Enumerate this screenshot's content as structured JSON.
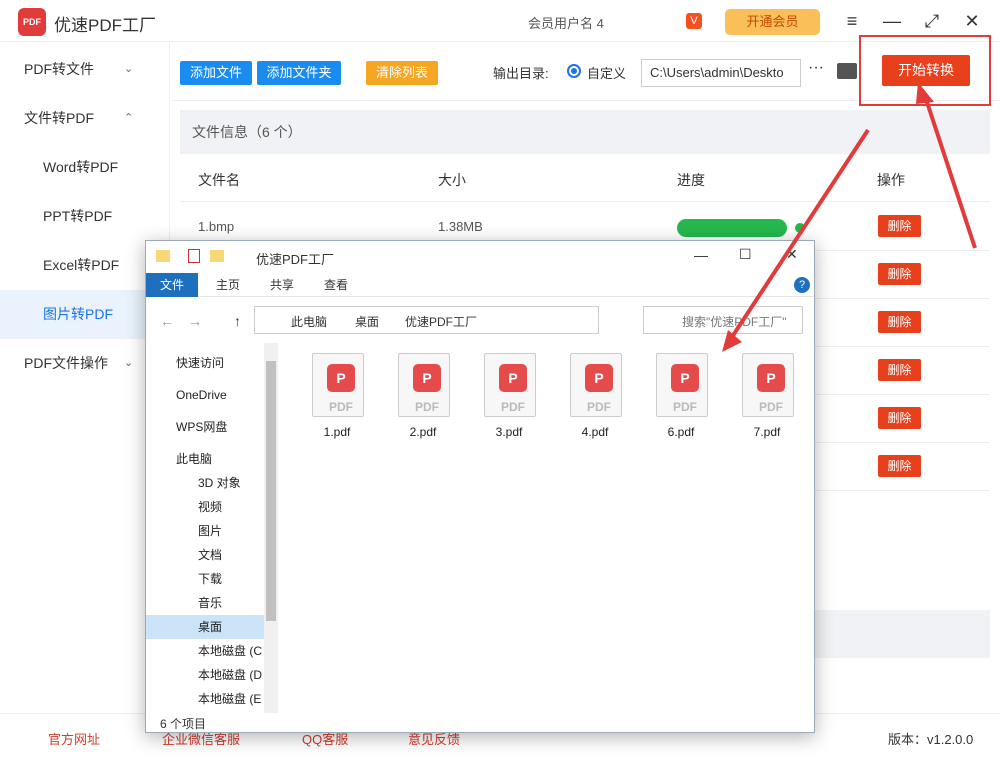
{
  "app": {
    "logo": "PDF",
    "title": "优速PDF工厂",
    "member_info": "会员用户名 4",
    "vip_badge": "V",
    "vip_button": "开通会员"
  },
  "window_controls": {
    "menu": "≡",
    "minimize": "—",
    "maximize": "⤢",
    "close": "✕"
  },
  "sidebar": {
    "items": [
      {
        "label": "PDF转文件",
        "chevron": "⌄"
      },
      {
        "label": "文件转PDF",
        "chevron": "⌃"
      },
      {
        "label": "Word转PDF"
      },
      {
        "label": "PPT转PDF"
      },
      {
        "label": "Excel转PDF"
      },
      {
        "label": "图片转PDF"
      },
      {
        "label": "PDF文件操作",
        "chevron": "⌄"
      }
    ]
  },
  "toolbar": {
    "add_file": "添加文件",
    "add_folder": "添加文件夹",
    "clear_list": "清除列表",
    "output_label": "输出目录:",
    "custom_label": "自定义",
    "output_path": "C:\\Users\\admin\\Deskto",
    "more": "···",
    "start": "开始转换"
  },
  "file_panel": {
    "info": "文件信息（6 个）",
    "headers": {
      "name": "文件名",
      "size": "大小",
      "progress": "进度",
      "action": "操作"
    },
    "rows": [
      {
        "name": "1.bmp",
        "size": "1.38MB",
        "progress": 1.0,
        "action": "删除"
      }
    ],
    "delete_label": "删除"
  },
  "bottom": {
    "website": "官方网址",
    "wechat": "企业微信客服",
    "qq": "QQ客服",
    "feedback": "意见反馈",
    "version": "版本：v1.2.0.0"
  },
  "explorer": {
    "title": "优速PDF工厂",
    "tabs": [
      "文件",
      "主页",
      "共享",
      "查看"
    ],
    "address": [
      "此电脑",
      "桌面",
      "优速PDF工厂"
    ],
    "search_placeholder": "搜索\"优速PDF工厂\"",
    "nav": [
      "快速访问",
      "OneDrive",
      "WPS网盘",
      "此电脑",
      "3D 对象",
      "视频",
      "图片",
      "文档",
      "下载",
      "音乐",
      "桌面",
      "本地磁盘 (C",
      "本地磁盘 (D",
      "本地磁盘 (E"
    ],
    "files": [
      "1.pdf",
      "2.pdf",
      "3.pdf",
      "4.pdf",
      "6.pdf",
      "7.pdf"
    ],
    "file_type_label": "PDF",
    "status": "6 个项目"
  },
  "colors": {
    "accent": "#1a73e8",
    "danger": "#e8401c",
    "success": "#25b84d",
    "vip": "#fbbf5a"
  }
}
